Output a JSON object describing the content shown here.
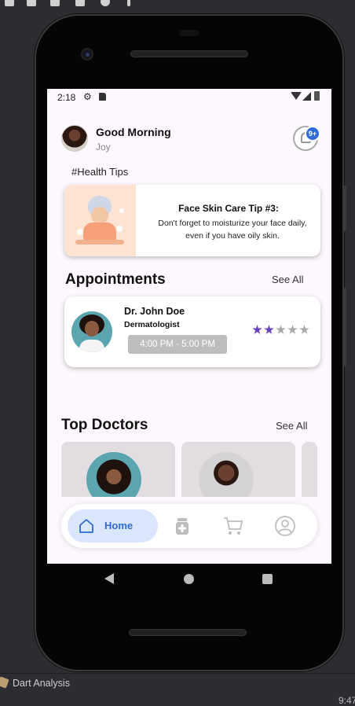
{
  "status_bar": {
    "time": "2:18"
  },
  "header": {
    "greeting": "Good Morning",
    "user_name": "Joy",
    "notification_badge": "9+"
  },
  "health_tips": {
    "label": "#Health Tips",
    "card": {
      "title": "Face Skin Care Tip #3:",
      "body_line1": "Don't forget to moisturize your face daily,",
      "body_line2": "even if you have oily skin."
    }
  },
  "appointments": {
    "title": "Appointments",
    "see_all": "See All",
    "items": [
      {
        "doctor": "Dr. John Doe",
        "specialty": "Dermatologist",
        "time": "4:00 PM - 5:00 PM",
        "rating": 2,
        "rating_max": 5
      }
    ]
  },
  "top_doctors": {
    "title": "Top Doctors",
    "see_all": "See All"
  },
  "bottom_nav": {
    "items": [
      {
        "label": "Home",
        "icon": "home-icon",
        "active": true
      },
      {
        "label": "",
        "icon": "medicine-icon",
        "active": false
      },
      {
        "label": "",
        "icon": "cart-icon",
        "active": false
      },
      {
        "label": "",
        "icon": "profile-icon",
        "active": false
      }
    ]
  },
  "ide": {
    "tool_window": "Dart Analysis",
    "clock": "9:47"
  },
  "colors": {
    "accent": "#2f6bd8",
    "active_nav_bg": "#dae6fb",
    "rating_star": "#6a3fc0",
    "screen_bg": "#fdf8fd"
  }
}
